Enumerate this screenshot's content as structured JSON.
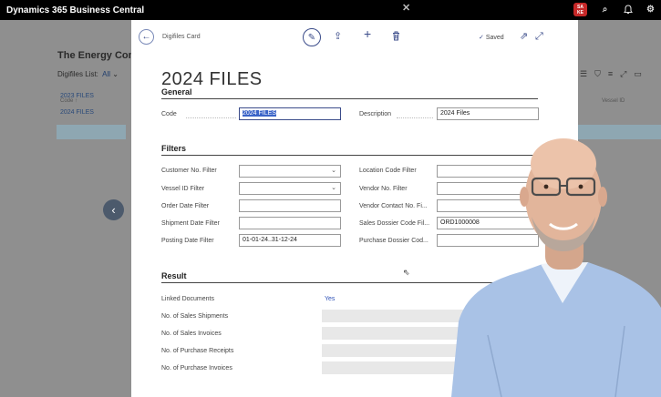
{
  "topbar": {
    "app_title": "Dynamics 365 Business Central",
    "avatar_initials": "SA\nKE"
  },
  "background": {
    "page_title": "The Energy Comp",
    "list_label": "Digifiles List:",
    "list_filter": "All",
    "col_code": "Code ↑",
    "col_vessel": "Vessel ID",
    "rows": [
      "2023 FILES",
      "2024 FILES"
    ]
  },
  "card": {
    "breadcrumb": "Digifiles Card",
    "saved_label": "Saved",
    "title": "2024 FILES",
    "general": {
      "heading": "General",
      "code_label": "Code",
      "code_value": "2024 FILES",
      "description_label": "Description",
      "description_value": "2024 Files"
    },
    "filters": {
      "heading": "Filters",
      "customer_no": "Customer No. Filter",
      "vessel_id": "Vessel ID Filter",
      "order_date": "Order Date Filter",
      "shipment_date": "Shipment Date Filter",
      "posting_date": "Posting Date Filter",
      "posting_date_value": "01-01-24..31-12-24",
      "location_code": "Location Code Filter",
      "vendor_no": "Vendor No. Filter",
      "vendor_contact": "Vendor Contact No. Fi...",
      "sales_dossier": "Sales Dossier Code Fil...",
      "sales_dossier_value": "ORD1000008",
      "purchase_dossier": "Purchase Dossier Cod..."
    },
    "result": {
      "heading": "Result",
      "linked_docs": "Linked Documents",
      "linked_docs_value": "Yes",
      "sales_shipments": "No. of Sales Shipments",
      "sales_invoices": "No. of Sales Invoices",
      "purchase_receipts": "No. of Purchase Receipts",
      "purchase_invoices": "No. of Purchase Invoices"
    }
  }
}
